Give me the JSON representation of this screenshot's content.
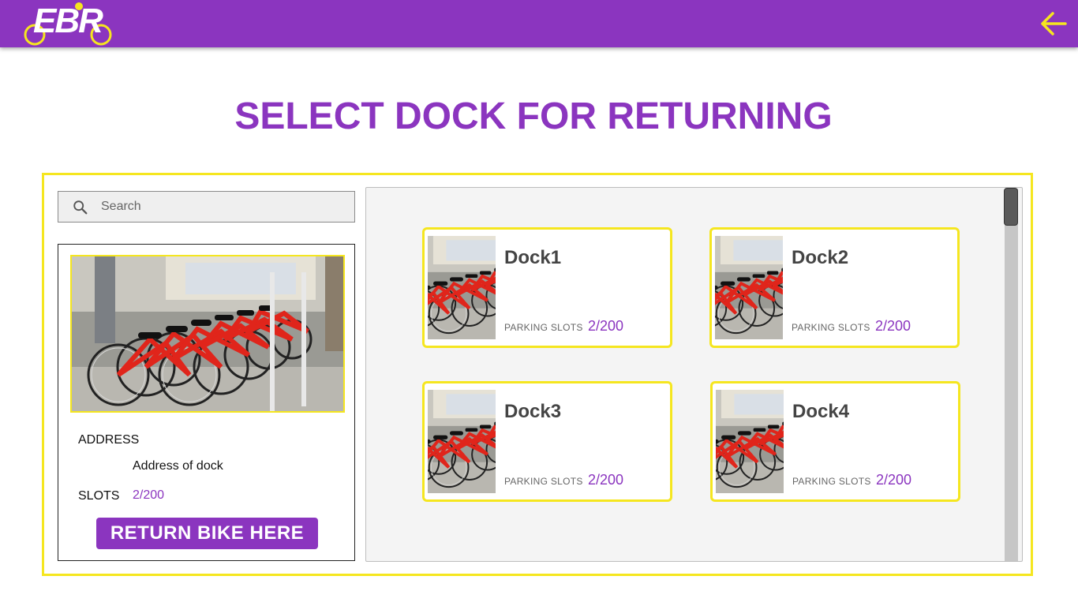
{
  "header": {
    "logo_text": "EBR",
    "back_icon": "arrow-left-icon",
    "colors": {
      "bar": "#8b35bf",
      "accent": "#f5e61f"
    }
  },
  "page": {
    "title": "SELECT DOCK FOR RETURNING"
  },
  "search": {
    "placeholder": "Search",
    "value": "",
    "icon": "search-icon"
  },
  "detail": {
    "address_label": "ADDRESS",
    "address_value": "Address of dock",
    "slots_label": "SLOTS",
    "slots_value": "2/200",
    "return_button": "RETURN BIKE HERE"
  },
  "docks": [
    {
      "name": "Dock1",
      "slots_label": "PARKING SLOTS",
      "slots_value": "2/200"
    },
    {
      "name": "Dock2",
      "slots_label": "PARKING SLOTS",
      "slots_value": "2/200"
    },
    {
      "name": "Dock3",
      "slots_label": "PARKING SLOTS",
      "slots_value": "2/200"
    },
    {
      "name": "Dock4",
      "slots_label": "PARKING SLOTS",
      "slots_value": "2/200"
    }
  ]
}
